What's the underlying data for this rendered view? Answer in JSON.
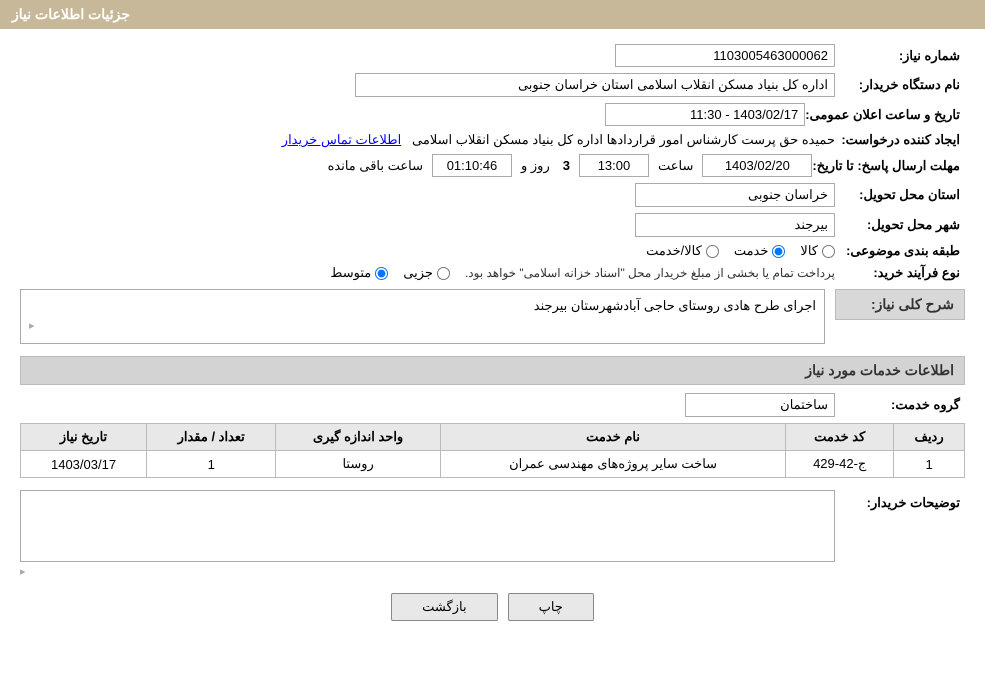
{
  "header": {
    "title": "جزئیات اطلاعات نیاز"
  },
  "fields": {
    "request_number_label": "شماره نیاز:",
    "request_number_value": "1103005463000062",
    "buyer_org_label": "نام دستگاه خریدار:",
    "buyer_org_value": "اداره کل بنیاد مسکن انقلاب اسلامی استان خراسان جنوبی",
    "creator_label": "ایجاد کننده درخواست:",
    "creator_value": "حمیده حق پرست کارشناس امور قراردادها اداره کل بنیاد مسکن انقلاب اسلامی",
    "creator_link": "اطلاعات تماس خریدار",
    "announce_datetime_label": "تاریخ و ساعت اعلان عمومی:",
    "announce_datetime_value": "1403/02/17 - 11:30",
    "deadline_label": "مهلت ارسال پاسخ: تا تاریخ:",
    "deadline_date": "1403/02/20",
    "deadline_time_label": "ساعت",
    "deadline_time": "13:00",
    "deadline_days_label": "روز و",
    "deadline_days": "3",
    "deadline_remaining_label": "ساعت باقی مانده",
    "deadline_remaining": "01:10:46",
    "province_label": "استان محل تحویل:",
    "province_value": "خراسان جنوبی",
    "city_label": "شهر محل تحویل:",
    "city_value": "بیرجند",
    "category_label": "طبقه بندی موضوعی:",
    "category_options": [
      "کالا",
      "خدمت",
      "کالا/خدمت"
    ],
    "category_selected": "خدمت",
    "purchase_type_label": "نوع فرآیند خرید:",
    "purchase_type_options": [
      "جزیی",
      "متوسط"
    ],
    "purchase_type_note": "پرداخت تمام یا بخشی از مبلغ خریدار محل \"اسناد خزانه اسلامی\" خواهد بود.",
    "purchase_type_selected": "متوسط",
    "need_desc_label": "شرح کلی نیاز:",
    "need_desc_value": "اجرای طرح هادی روستای حاجی آبادشهرستان بیرجند",
    "services_section_label": "اطلاعات خدمات مورد نیاز",
    "service_group_label": "گروه خدمت:",
    "service_group_value": "ساختمان",
    "table_headers": [
      "ردیف",
      "کد خدمت",
      "نام خدمت",
      "واحد اندازه گیری",
      "تعداد / مقدار",
      "تاریخ نیاز"
    ],
    "table_rows": [
      {
        "row": "1",
        "code": "ج-42-429",
        "name": "ساخت سایر پروژه‌های مهندسی عمران",
        "unit": "روستا",
        "quantity": "1",
        "date": "1403/03/17"
      }
    ],
    "buyer_notes_label": "توضیحات خریدار:",
    "buyer_notes_value": "",
    "print_button": "چاپ",
    "back_button": "بازگشت"
  }
}
